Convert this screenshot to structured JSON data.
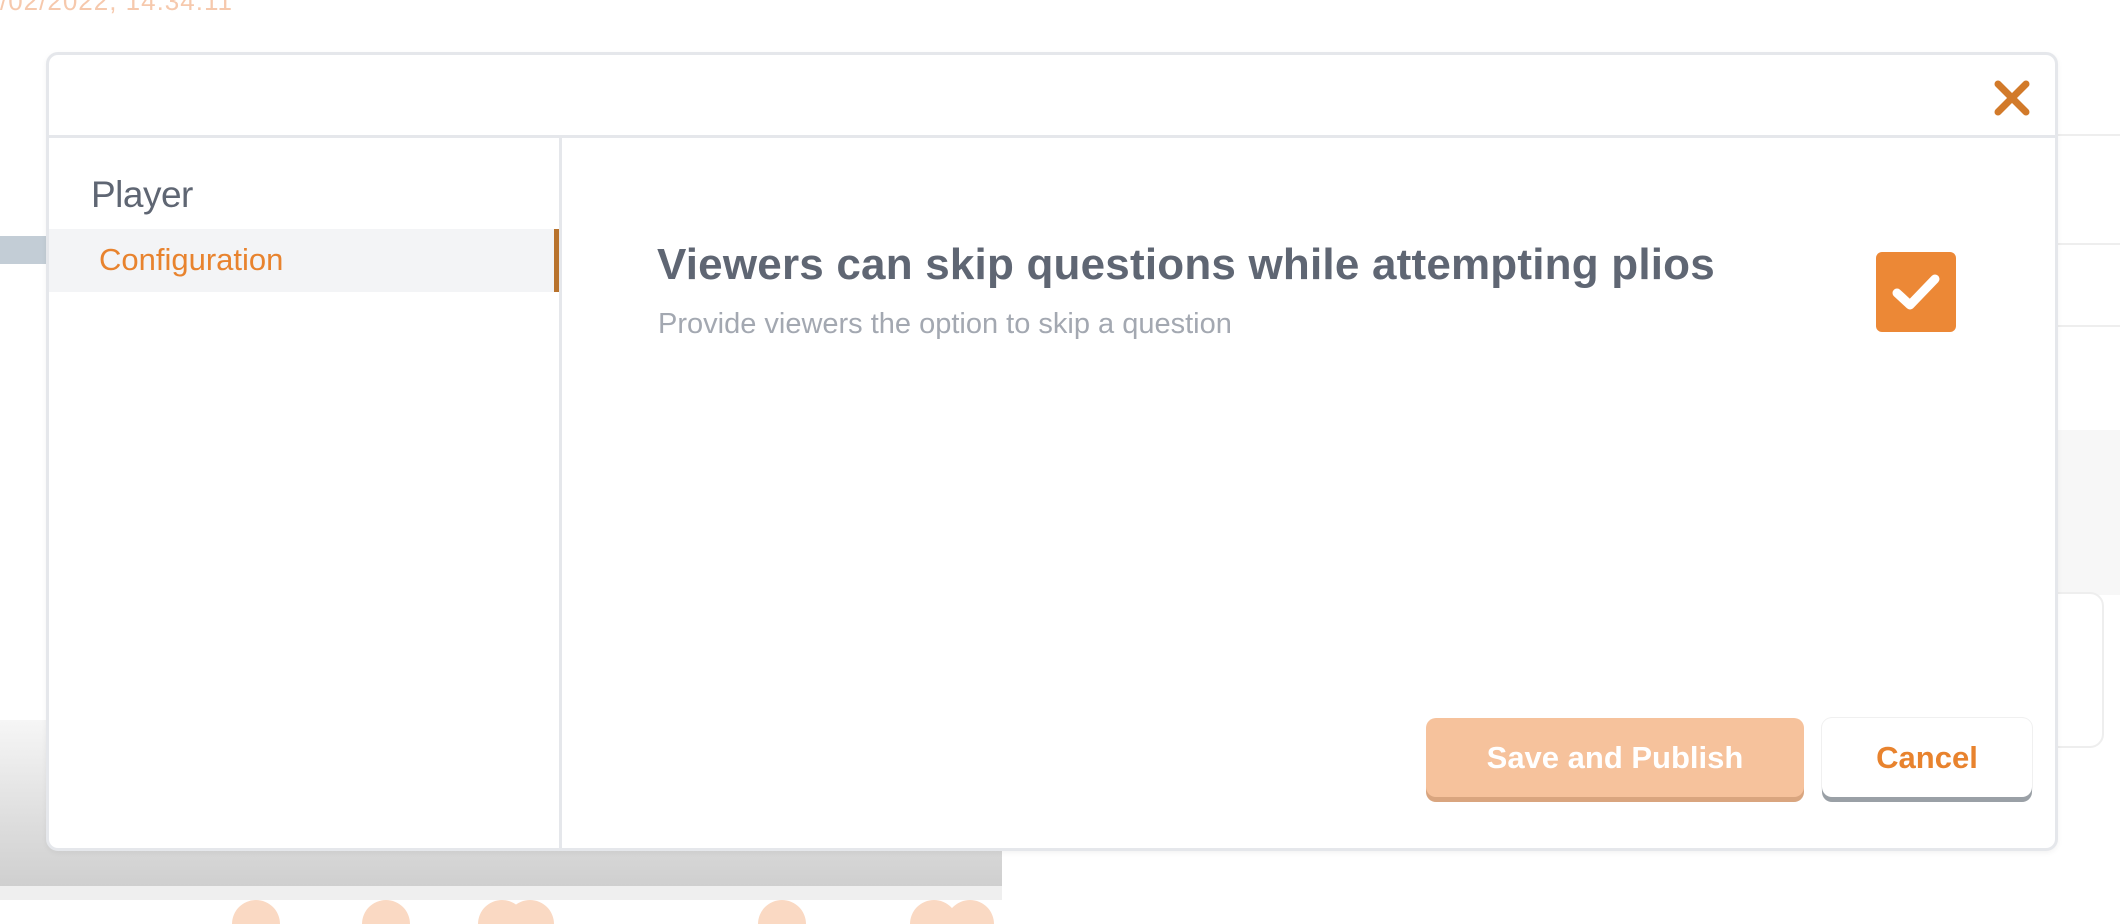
{
  "background": {
    "timestamp_fragment": "/02/2022, 14:34:11"
  },
  "modal": {
    "close_icon": "close-x-icon",
    "sidebar": {
      "heading": "Player",
      "items": [
        {
          "label": "Configuration",
          "active": true
        }
      ]
    },
    "setting": {
      "title": "Viewers can skip questions while attempting plios",
      "description": "Provide viewers the option to skip a question",
      "checked": true,
      "check_icon": "checkmark-icon"
    },
    "footer": {
      "save_label": "Save and Publish",
      "cancel_label": "Cancel"
    }
  },
  "colors": {
    "accent": "#e8832e",
    "checkbox": "#ec8836",
    "save_button": "#f6c29c",
    "active_border": "#b8722c",
    "text_dark": "#5f6673",
    "text_muted": "#a3a8b1"
  }
}
